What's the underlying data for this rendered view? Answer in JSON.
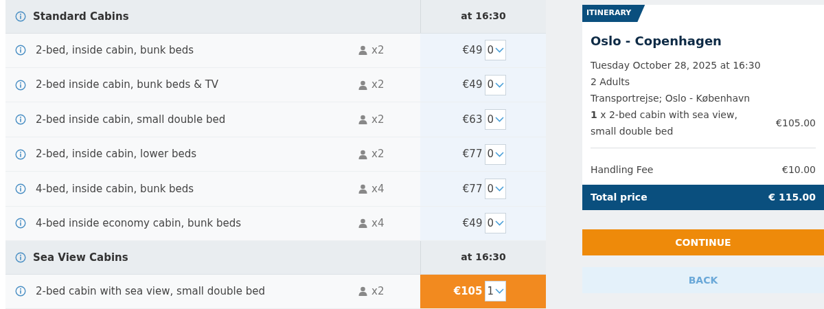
{
  "sections": [
    {
      "title": "Standard Cabins",
      "time": "at 16:30",
      "cabins": [
        {
          "name": "2-bed, inside cabin, bunk beds",
          "persons": "x2",
          "price": "€49",
          "quantity": "0",
          "selected": false
        },
        {
          "name": "2-bed inside cabin, bunk beds & TV",
          "persons": "x2",
          "price": "€49",
          "quantity": "0",
          "selected": false
        },
        {
          "name": "2-bed inside cabin, small double bed",
          "persons": "x2",
          "price": "€63",
          "quantity": "0",
          "selected": false
        },
        {
          "name": "2-bed, inside cabin, lower beds",
          "persons": "x2",
          "price": "€77",
          "quantity": "0",
          "selected": false
        },
        {
          "name": "4-bed, inside cabin, bunk beds",
          "persons": "x4",
          "price": "€77",
          "quantity": "0",
          "selected": false
        },
        {
          "name": "4-bed inside economy cabin, bunk beds",
          "persons": "x4",
          "price": "€49",
          "quantity": "0",
          "selected": false
        }
      ]
    },
    {
      "title": "Sea View Cabins",
      "time": "at 16:30",
      "cabins": [
        {
          "name": "2-bed cabin with sea view, small double bed",
          "persons": "x2",
          "price": "€105",
          "quantity": "1",
          "selected": true
        }
      ]
    }
  ],
  "itinerary": {
    "tag": "ITINERARY",
    "route": "Oslo - Copenhagen",
    "date": "Tuesday October 28, 2025 at 16:30",
    "passengers": "2 Adults",
    "trip": "Transportrejse; Oslo - København",
    "items": [
      {
        "label": "**1** x 2-bed cabin with sea view, small double bed",
        "price": "€105.00"
      }
    ],
    "fee": {
      "label": "Handling Fee",
      "price": "€10.00"
    },
    "total": {
      "label": "Total price",
      "price": "€ 115.00"
    }
  },
  "buttons": [
    {
      "label": "CONTINUE",
      "kind": "primary"
    },
    {
      "label": "BACK",
      "kind": "secondary"
    }
  ]
}
